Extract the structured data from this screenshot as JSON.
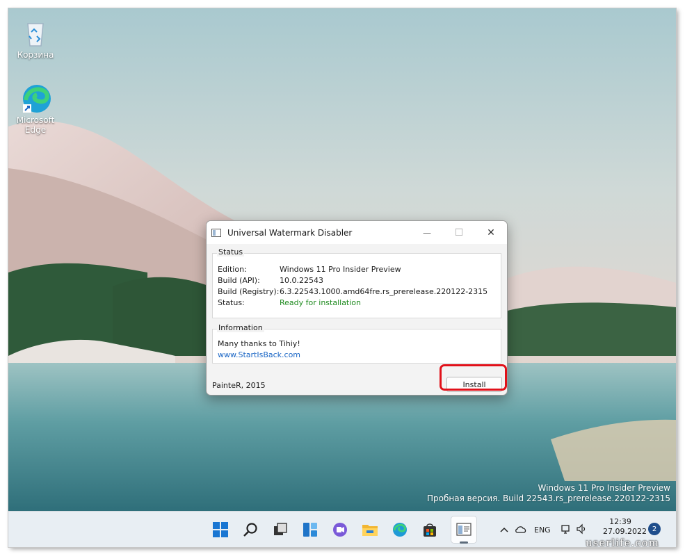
{
  "desktop": {
    "icons": [
      {
        "label": "Корзина",
        "icon": "recycle-bin-icon"
      },
      {
        "label": "Microsoft Edge",
        "icon": "edge-icon"
      }
    ],
    "watermark": {
      "line1": "Windows 11 Pro Insider Preview",
      "line2": "Пробная версия. Build 22543.rs_prerelease.220122-2315"
    }
  },
  "dialog": {
    "title": "Universal Watermark Disabler",
    "status_group": {
      "legend": "Status",
      "rows": [
        {
          "label": "Edition:",
          "value": "Windows 11 Pro Insider Preview"
        },
        {
          "label": "Build (API):",
          "value": "10.0.22543"
        },
        {
          "label": "Build (Registry):",
          "value": "6.3.22543.1000.amd64fre.rs_prerelease.220122-2315"
        },
        {
          "label": "Status:",
          "value": "Ready for installation"
        }
      ]
    },
    "info_group": {
      "legend": "Information",
      "thanks": "Many thanks to Tihiy!",
      "link": "www.StartIsBack.com"
    },
    "footer": "PainteR, 2015",
    "install_label": "Install",
    "controls": {
      "minimize": "—",
      "maximize": "☐",
      "close": "✕"
    }
  },
  "taskbar": {
    "apps": [
      "start-icon",
      "search-icon",
      "task-view-icon",
      "widgets-icon",
      "chat-icon",
      "file-explorer-icon",
      "edge-icon",
      "store-icon",
      "uwd-app-icon"
    ],
    "language": "ENG",
    "time": "12:39",
    "date": "27.09.2022",
    "notifications": "2"
  },
  "site_watermark": "userlife.com",
  "colors": {
    "accent": "#e1111a",
    "status_ok": "#1e8a1e",
    "link": "#1a66c5"
  }
}
